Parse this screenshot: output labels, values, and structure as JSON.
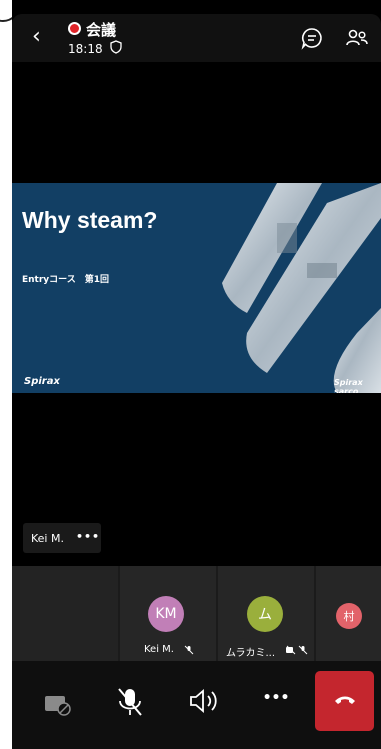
{
  "header": {
    "title": "会議",
    "time": "18:18"
  },
  "slide": {
    "title": "Why steam?",
    "subtitle": "Entryコース　第1回",
    "logo_left": "Spirax",
    "logo_right": "Spirax sarco"
  },
  "speaker_tag": {
    "name": "Kei M.",
    "more": "•••"
  },
  "participants": [
    {
      "initials": "KM",
      "name": "Kei M.",
      "color": "#c17fb7"
    },
    {
      "initials": "ム",
      "name": "ムラカミ...",
      "color": "#9aaf3c"
    },
    {
      "initials": "村",
      "name": "",
      "color": "#e2636a"
    }
  ],
  "controls": {
    "more": "•••"
  },
  "colors": {
    "end_call": "#c4262e",
    "recording": "#e0252a"
  }
}
